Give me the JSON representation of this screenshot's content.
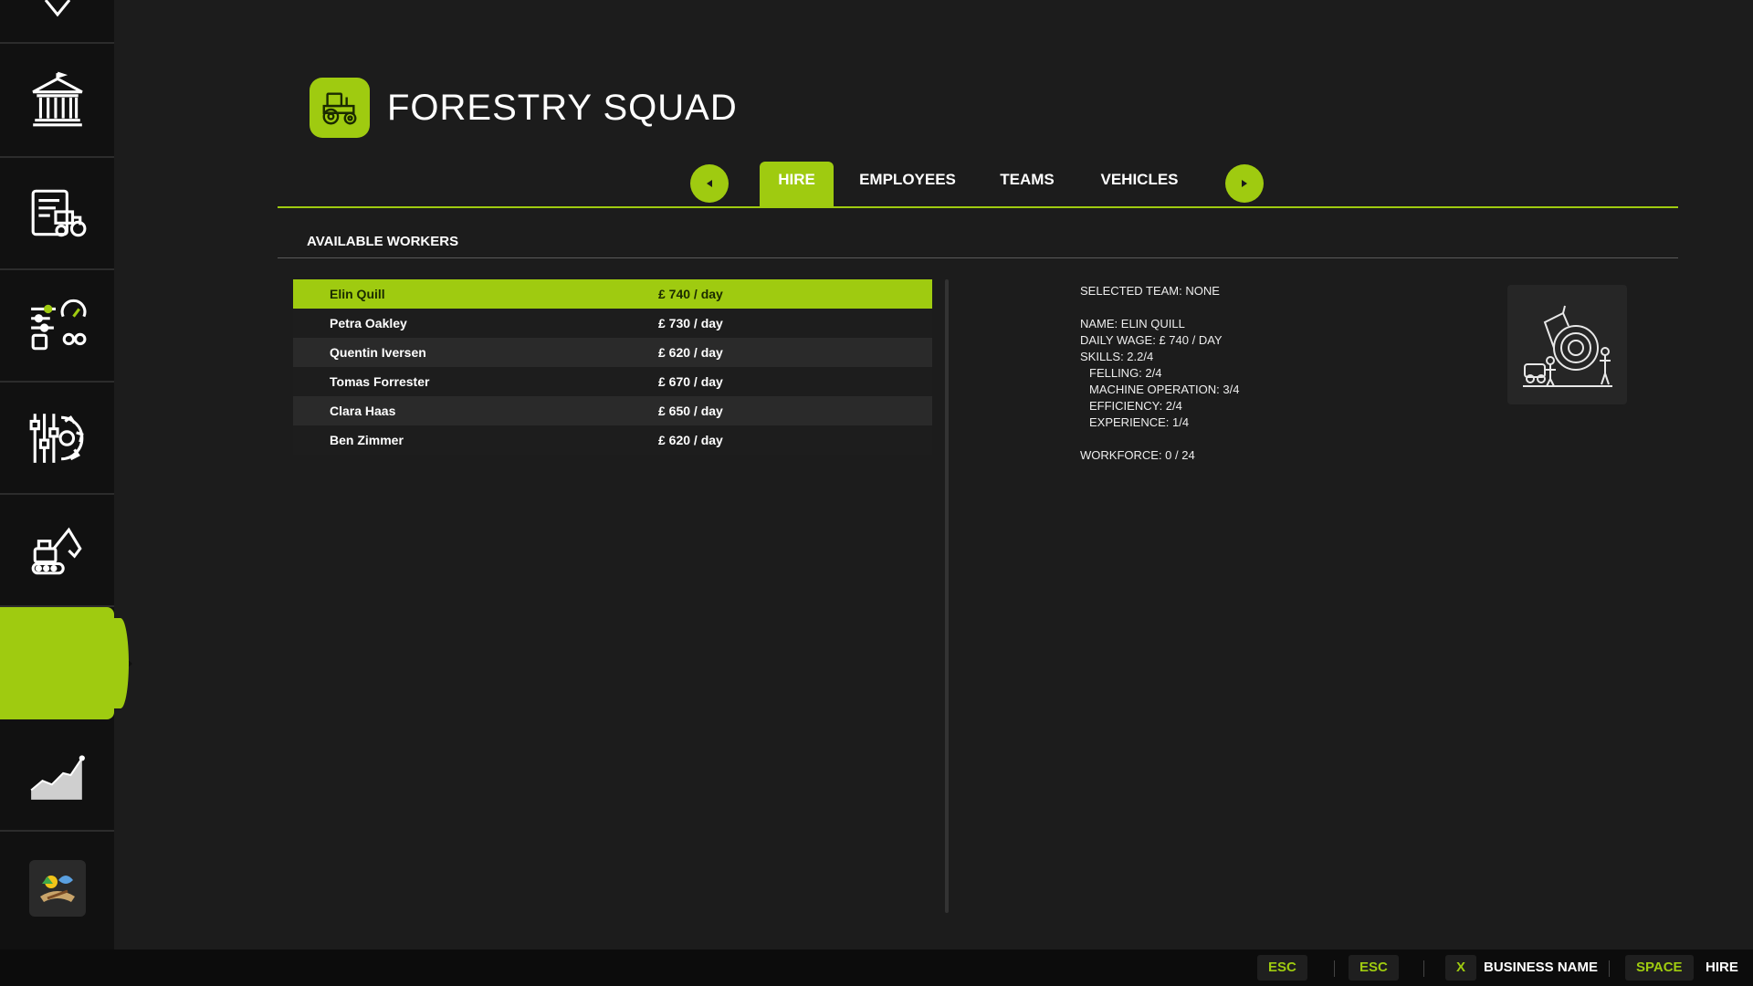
{
  "header": {
    "title": "FORESTRY SQUAD",
    "icon": "tractor-icon"
  },
  "sidebar": {
    "items": [
      {
        "icon": "map-pin-icon"
      },
      {
        "icon": "bank-icon"
      },
      {
        "icon": "contracts-icon"
      },
      {
        "icon": "settings-sliders-icon"
      },
      {
        "icon": "gear-sliders-icon"
      },
      {
        "icon": "excavator-icon"
      },
      {
        "icon": "active-item",
        "active": true
      },
      {
        "icon": "stats-chart-icon"
      },
      {
        "icon": "farm-thumbnail-icon"
      }
    ]
  },
  "tabs": [
    {
      "label": "HIRE",
      "active": true
    },
    {
      "label": "EMPLOYEES"
    },
    {
      "label": "TEAMS"
    },
    {
      "label": "VEHICLES"
    }
  ],
  "section": {
    "title": "AVAILABLE WORKERS"
  },
  "workers": [
    {
      "name": "Elin Quill",
      "wage": "£ 740 / day"
    },
    {
      "name": "Petra Oakley",
      "wage": "£ 730 / day"
    },
    {
      "name": "Quentin Iversen",
      "wage": "£ 620 / day"
    },
    {
      "name": "Tomas Forrester",
      "wage": "£ 670 / day"
    },
    {
      "name": "Clara Haas",
      "wage": "£ 650 / day"
    },
    {
      "name": "Ben Zimmer",
      "wage": "£ 620 / day"
    }
  ],
  "details": {
    "selected_team": "SELECTED TEAM: NONE",
    "name": "NAME: ELIN QUILL",
    "daily_wage": "DAILY WAGE: £ 740 / DAY",
    "skills": "SKILLS: 2.2/4",
    "felling": "FELLING: 2/4",
    "machine_operation": "MACHINE OPERATION: 3/4",
    "efficiency": "EFFICIENCY: 2/4",
    "experience": "EXPERIENCE: 1/4",
    "workforce": "WORKFORCE: 0 / 24",
    "image_icon": "forestry-worker-illustration"
  },
  "footer": {
    "key1": "ESC",
    "key2": "ESC",
    "key3": "X",
    "label3": "BUSINESS NAME",
    "key4": "SPACE",
    "label4": "HIRE"
  },
  "colors": {
    "accent": "#9fcb10",
    "background": "#1c1c1c",
    "sidebar": "#111111"
  }
}
